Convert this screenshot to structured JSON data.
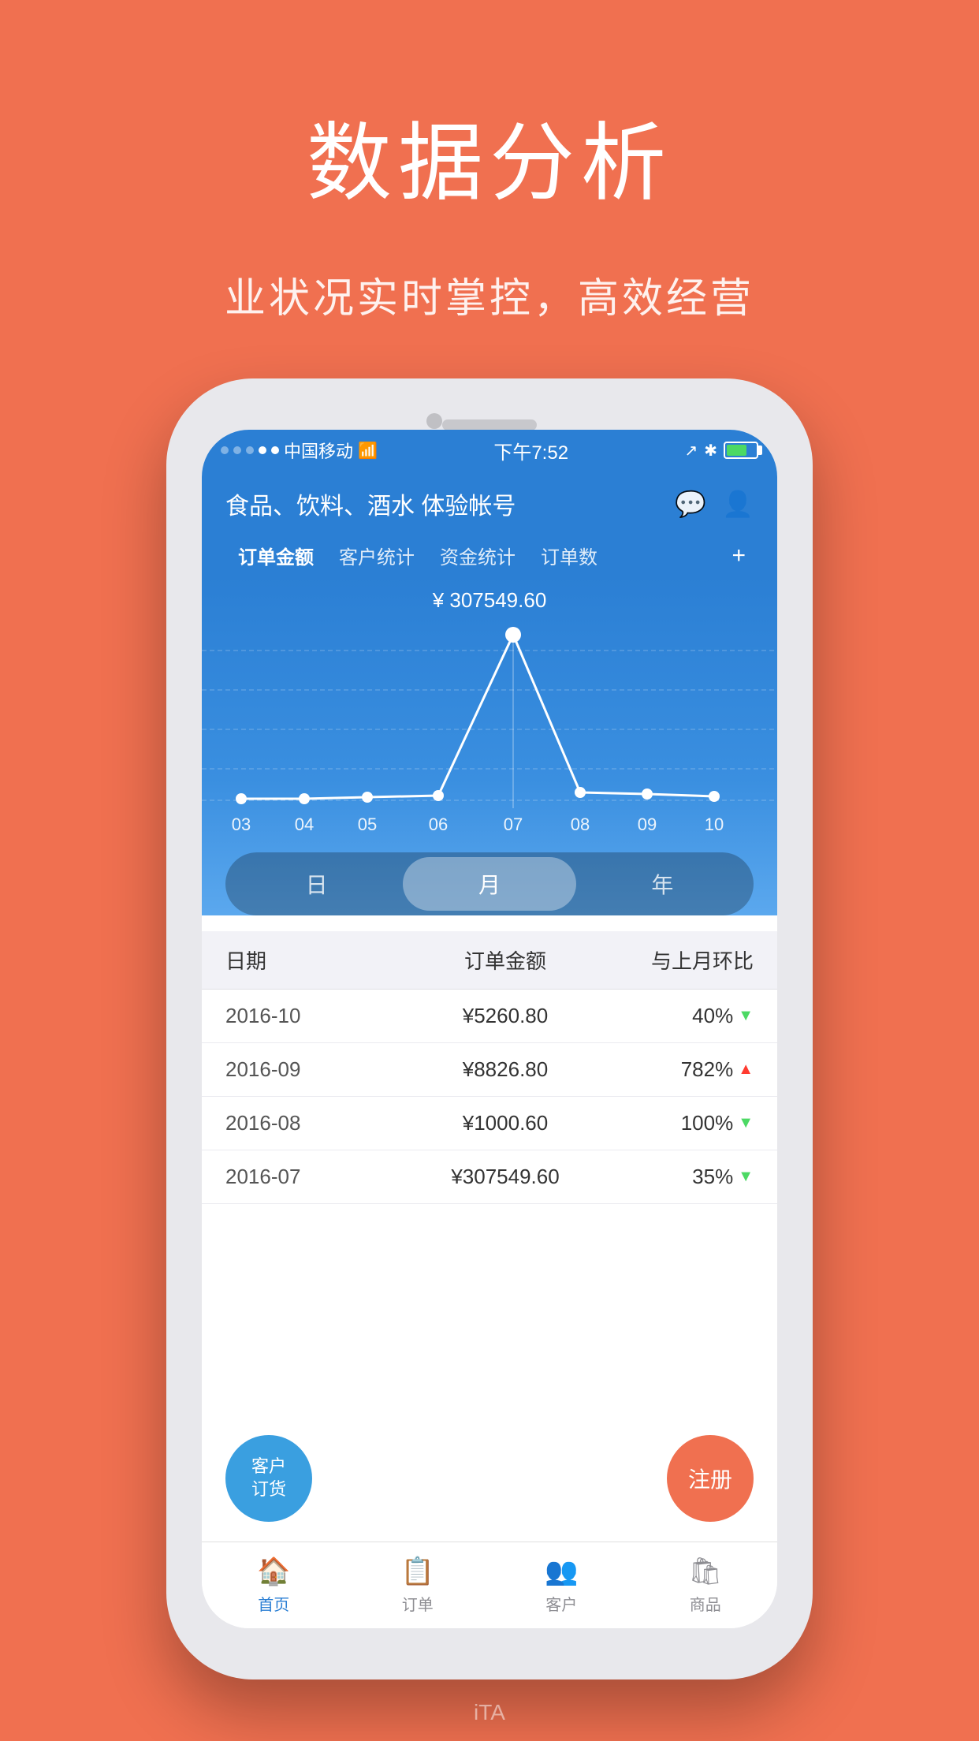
{
  "hero": {
    "title": "数据分析",
    "subtitle": "业状况实时掌控，高效经营"
  },
  "status_bar": {
    "carrier": "中国移动",
    "time": "下午7:52",
    "signal_dots": [
      "dim",
      "dim",
      "dim",
      "on",
      "on"
    ]
  },
  "app_header": {
    "title": "食品、饮料、酒水 体验帐号",
    "tabs": [
      "订单金额",
      "客户统计",
      "资金统计",
      "订单数"
    ],
    "plus_label": "+"
  },
  "chart": {
    "current_value": "¥ 307549.60",
    "x_labels": [
      "03",
      "04",
      "05",
      "06",
      "07",
      "08",
      "09",
      "10"
    ],
    "period_buttons": [
      "日",
      "月",
      "年"
    ],
    "active_period": "月"
  },
  "table": {
    "headers": [
      "日期",
      "订单金额",
      "与上月环比"
    ],
    "rows": [
      {
        "date": "2016-10",
        "amount": "¥5260.80",
        "change": "40%",
        "direction": "down"
      },
      {
        "date": "2016-09",
        "amount": "¥8826.80",
        "change": "782%",
        "direction": "up"
      },
      {
        "date": "2016-08",
        "amount": "¥1000.60",
        "change": "100%",
        "direction": "down"
      },
      {
        "date": "2016-07",
        "amount": "¥307549.60",
        "change": "35%",
        "direction": "down"
      }
    ]
  },
  "fab": {
    "customer_label": "客户\n订货",
    "register_label": "注册"
  },
  "bottom_nav": {
    "items": [
      {
        "icon": "🏠",
        "label": "首页",
        "active": true
      },
      {
        "icon": "📋",
        "label": "订单",
        "active": false
      },
      {
        "icon": "👥",
        "label": "客户",
        "active": false
      },
      {
        "icon": "🛍",
        "label": "商品",
        "active": false
      }
    ]
  },
  "watermark": "iTA"
}
